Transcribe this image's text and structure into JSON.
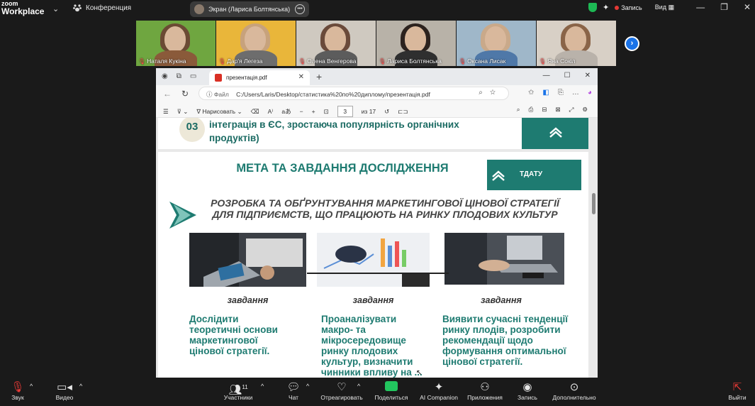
{
  "app": {
    "logo_line1": "zoom",
    "logo_line2": "Workplace",
    "conference_label": "Конференция",
    "screen_label": "Экран (Лариса Болтянська)",
    "record_label": "Запись",
    "view_label": "Вид"
  },
  "participants": [
    {
      "name": "Наталя Кукіна",
      "bg": "#6fa640",
      "hair": "#6b4a34",
      "body": "#8a5a3a",
      "active": false
    },
    {
      "name": "Дар'я Легеза",
      "bg": "#e9b63a",
      "hair": "#c7a27c",
      "body": "#6d6d6d",
      "active": false
    },
    {
      "name": "Олена Венгерова",
      "bg": "#cfc9c0",
      "hair": "#6a4a3a",
      "body": "#5c5c5c",
      "active": false
    },
    {
      "name": "Лариса Болтянська",
      "bg": "#b8b2a8",
      "hair": "#2c221e",
      "body": "#2f2f2f",
      "active": true
    },
    {
      "name": "Оксана Лисак",
      "bg": "#9fb7c9",
      "hair": "#c9a98a",
      "body": "#4f78a8",
      "active": false
    },
    {
      "name": "Яна Сокіл",
      "bg": "#d8d0c6",
      "hair": "#8a6448",
      "body": "#b9b2aa",
      "active": false
    }
  ],
  "browser": {
    "tab_title": "презентація.pdf",
    "file_label": "Файл",
    "url": "C:/Users/Laris/Desktop/статистика%20по%20диплому/презентація.pdf",
    "draw_label": "Нарисовать",
    "page_current": "3",
    "page_total": "из 17"
  },
  "pdf_prev": {
    "number": "03",
    "text": "інтеграція в ЄС, зростаюча популярність органічних продуктів)"
  },
  "slide": {
    "title": "МЕТА ТА ЗАВДАННЯ ДОСЛІДЖЕННЯ",
    "logo_text": "ТДАТУ",
    "subtitle": "РОЗРОБКА ТА ОБҐРУНТУВАННЯ МАРКЕТИНГОВОЇ ЦІНОВОЇ СТРАТЕГІЇ ДЛЯ ПІДПРИЄМСТВ, ЩО ПРАЦЮЮТЬ НА РИНКУ ПЛОДОВИХ КУЛЬТУР",
    "tasks": [
      {
        "label": "завдання",
        "text": "Дослідити теоретичні основи маркетингової цінової стратегії."
      },
      {
        "label": "завдання",
        "text": "Проаналізувати макро- та мікросередовище ринку плодових культур, визначити чинники впливу на ..."
      },
      {
        "label": "завдання",
        "text": "Виявити сучасні тенденції ринку плодів, розробити рекомендації щодо формування оптимальної цінової стратегії."
      }
    ],
    "accent": "#1e7b71"
  },
  "toolbar": {
    "sound": "Звук",
    "video": "Видео",
    "participants": "Участники",
    "participants_count": "11",
    "chat": "Чат",
    "react": "Отреагировать",
    "share": "Поделиться",
    "ai": "AI Companion",
    "apps": "Приложения",
    "record": "Запись",
    "more": "Дополнительно",
    "leave": "Выйти"
  }
}
